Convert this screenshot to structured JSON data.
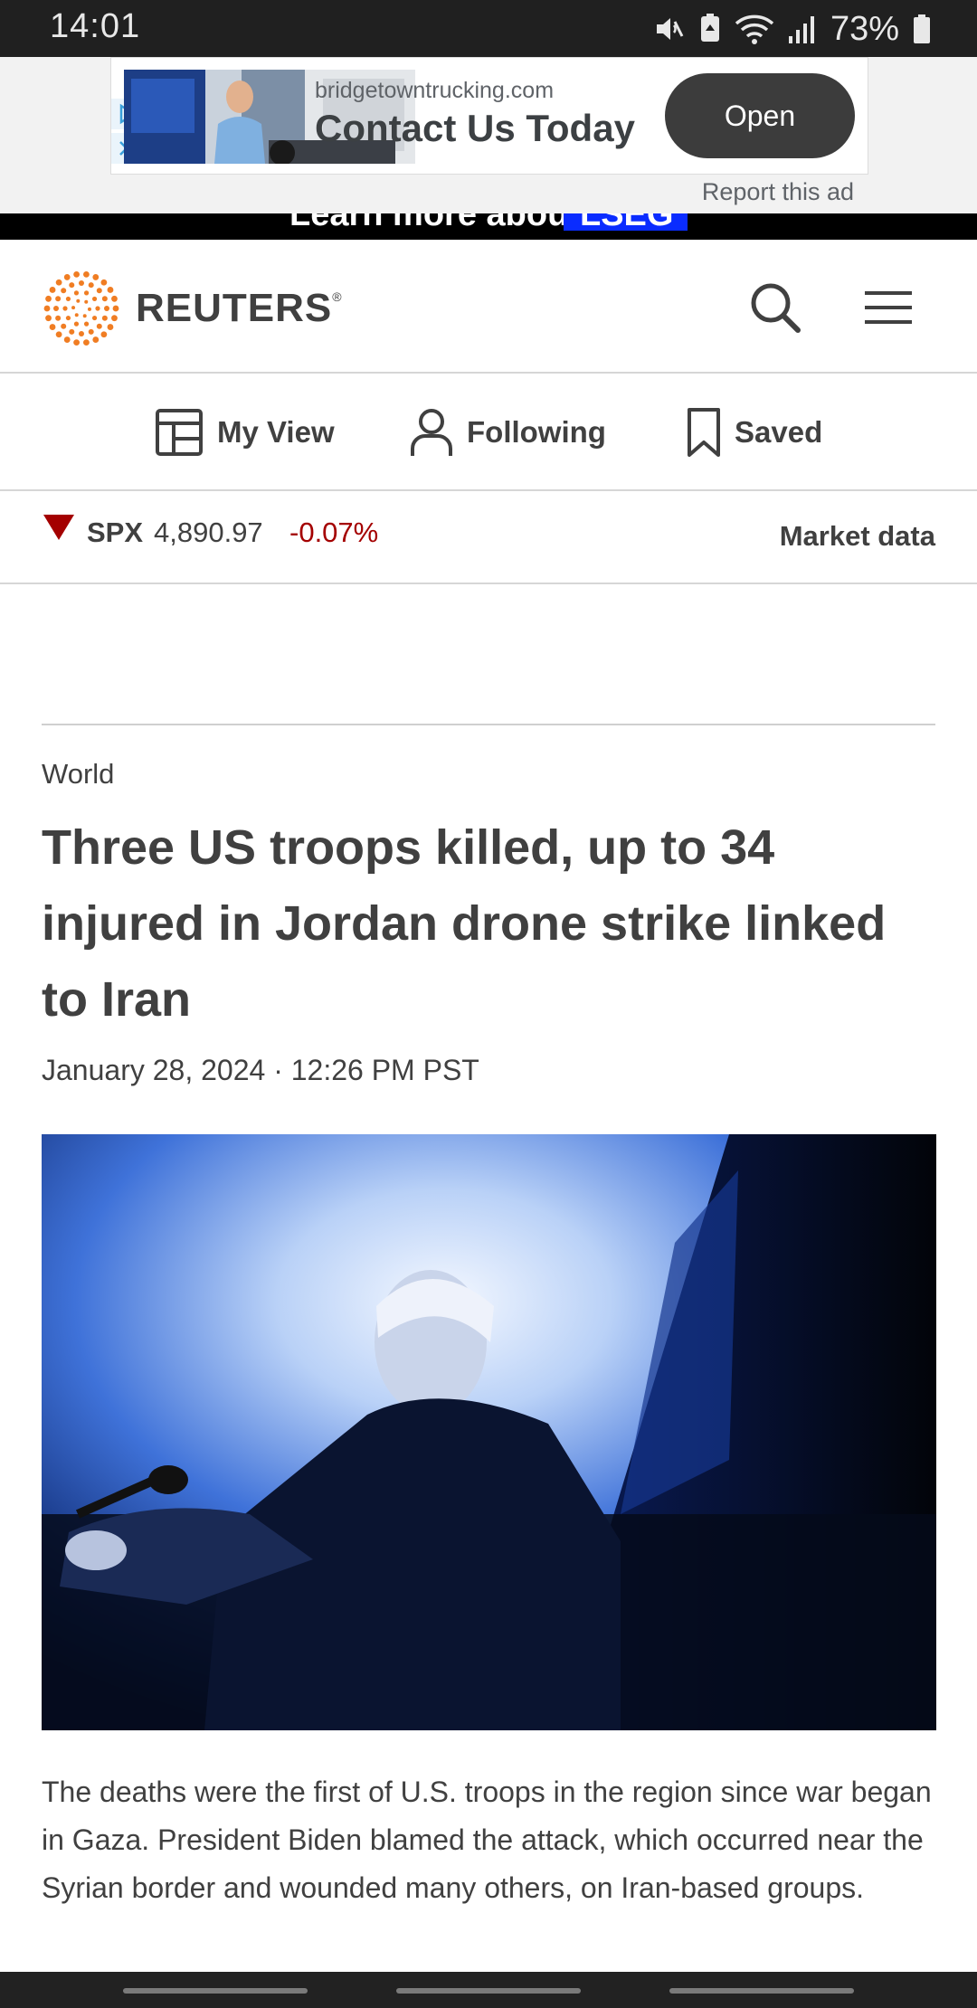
{
  "status_bar": {
    "time": "14:01",
    "battery": "73%"
  },
  "ad": {
    "domain": "bridgetowntrucking.com",
    "headline": "Contact Us Today",
    "cta": "Open",
    "report": "Report this ad"
  },
  "promo": {
    "text": "Learn more about",
    "brand": "LSEG"
  },
  "header": {
    "logo": "REUTERS",
    "logo_mark": "®"
  },
  "nav": {
    "my_view": "My View",
    "following": "Following",
    "saved": "Saved"
  },
  "ticker": {
    "symbol": "SPX",
    "value": "4,890.97",
    "change": "-0.07%",
    "direction": "down",
    "market_link": "Market data"
  },
  "article": {
    "section": "World",
    "headline": "Three US troops killed, up to 34 injured in Jordan drone strike linked to Iran",
    "dateline": "January 28, 2024 · 12:26 PM PST",
    "summary": "The deaths were the first of U.S. troops in the region since war began in Gaza. President Biden blamed the attack, which occurred near the Syrian border and wounded many others, on Iran-based groups."
  },
  "colors": {
    "brand_orange": "#f07d23",
    "negative": "#a40000",
    "text": "#404040",
    "promo_blue": "#0a2cff"
  }
}
